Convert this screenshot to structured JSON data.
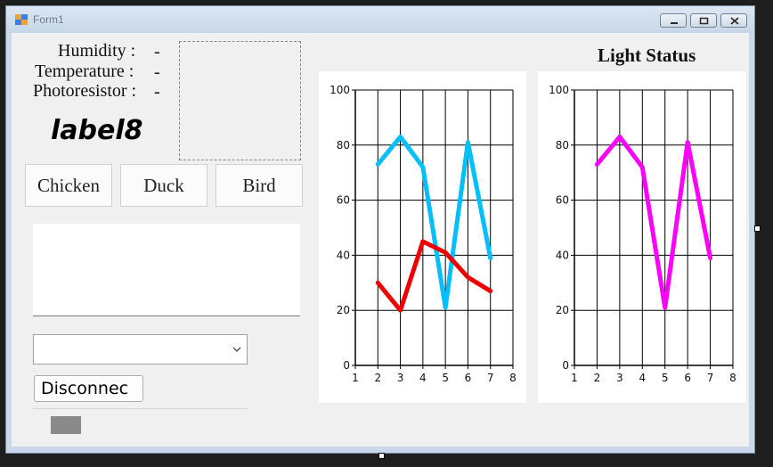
{
  "window": {
    "title": "Form1"
  },
  "labels": {
    "humidity": "Humidity :",
    "temperature": "Temperature :",
    "photoresistor": "Photoresistor :",
    "humidity_value": "-",
    "temperature_value": "-",
    "photoresistor_value": "-",
    "label8": "label8",
    "light_status": "Light Status"
  },
  "buttons": {
    "chicken": "Chicken",
    "duck": "Duck",
    "bird": "Bird",
    "disconnect": "Disconnec"
  },
  "combo": {
    "value": ""
  },
  "colors": {
    "series_cyan": "#00bfff",
    "series_red": "#ee0000",
    "series_magenta": "#ff00ff"
  },
  "chart_data": [
    {
      "type": "line",
      "xlim": [
        1,
        8
      ],
      "ylim": [
        0,
        100
      ],
      "x_ticks": [
        1,
        2,
        3,
        4,
        5,
        6,
        7,
        8
      ],
      "y_ticks": [
        0,
        20,
        40,
        60,
        80,
        100
      ],
      "grid": true,
      "series": [
        {
          "color": "#00bfff",
          "x": [
            2,
            3,
            4,
            5,
            6,
            7
          ],
          "y": [
            73,
            83,
            72,
            21,
            81,
            39
          ]
        },
        {
          "color": "#ee0000",
          "x": [
            2,
            3,
            4,
            5,
            6,
            7
          ],
          "y": [
            30,
            20,
            45,
            41,
            32,
            27
          ]
        }
      ]
    },
    {
      "type": "line",
      "xlim": [
        1,
        8
      ],
      "ylim": [
        0,
        100
      ],
      "x_ticks": [
        1,
        2,
        3,
        4,
        5,
        6,
        7,
        8
      ],
      "y_ticks": [
        0,
        20,
        40,
        60,
        80,
        100
      ],
      "grid": true,
      "series": [
        {
          "color": "#ff00ff",
          "x": [
            2,
            3,
            4,
            5,
            6,
            7
          ],
          "y": [
            73,
            83,
            72,
            21,
            81,
            39
          ]
        }
      ]
    }
  ]
}
